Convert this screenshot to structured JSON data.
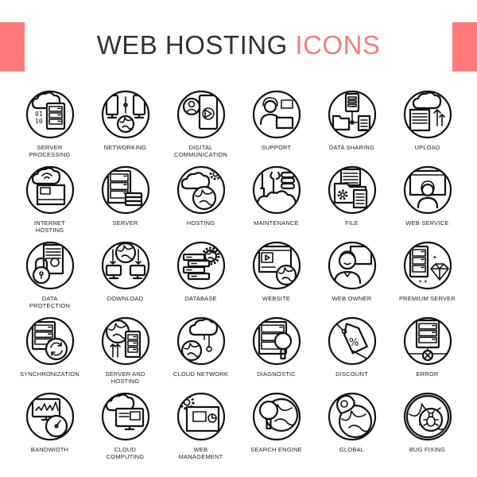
{
  "header": {
    "title_main": "WEB HOSTING",
    "title_accent": "ICONS",
    "accent_color": "#f28080",
    "bar_color": "#ff7b7b",
    "text_color": "#333333"
  },
  "icons": [
    {
      "label": "SERVER\nPROCESSING",
      "icon": "server-processing-icon"
    },
    {
      "label": "NETWORKING",
      "icon": "networking-icon"
    },
    {
      "label": "DIGITAL\nCOMMUNICATION",
      "icon": "digital-communication-icon"
    },
    {
      "label": "SUPPORT",
      "icon": "support-icon"
    },
    {
      "label": "DATA SHARING",
      "icon": "data-sharing-icon"
    },
    {
      "label": "UPLOAD",
      "icon": "upload-icon"
    },
    {
      "label": "INTERNET\nHOSTING",
      "icon": "internet-hosting-icon"
    },
    {
      "label": "SERVER",
      "icon": "server-icon"
    },
    {
      "label": "HOSTING",
      "icon": "hosting-icon"
    },
    {
      "label": "MAINTENANCE",
      "icon": "maintenance-icon"
    },
    {
      "label": "FILE",
      "icon": "file-icon"
    },
    {
      "label": "WEB SERVICE",
      "icon": "web-service-icon"
    },
    {
      "label": "DATA\nPROTECTION",
      "icon": "data-protection-icon"
    },
    {
      "label": "DOWNLOAD",
      "icon": "download-icon"
    },
    {
      "label": "DATABASE",
      "icon": "database-icon"
    },
    {
      "label": "WEBSITE",
      "icon": "website-icon"
    },
    {
      "label": "WEB OWNER",
      "icon": "web-owner-icon"
    },
    {
      "label": "PREMIUM SERVER",
      "icon": "premium-server-icon"
    },
    {
      "label": "SYNCHRONIZATION",
      "icon": "synchronization-icon"
    },
    {
      "label": "SERVER AND\nHOSTING",
      "icon": "server-and-hosting-icon"
    },
    {
      "label": "CLOUD NETWORK",
      "icon": "cloud-network-icon"
    },
    {
      "label": "DIAGNOSTIC",
      "icon": "diagnostic-icon"
    },
    {
      "label": "DISCOUNT",
      "icon": "discount-icon"
    },
    {
      "label": "ERROR",
      "icon": "error-icon"
    },
    {
      "label": "BANDWIDTH",
      "icon": "bandwidth-icon"
    },
    {
      "label": "CLOUD\nCOMPUTING",
      "icon": "cloud-computing-icon"
    },
    {
      "label": "WEB\nMANAGEMENT",
      "icon": "web-management-icon"
    },
    {
      "label": "SEARCH ENGINE",
      "icon": "search-engine-icon"
    },
    {
      "label": "GLOBAL",
      "icon": "global-icon"
    },
    {
      "label": "BUG FIXING",
      "icon": "bug-fixing-icon"
    }
  ]
}
